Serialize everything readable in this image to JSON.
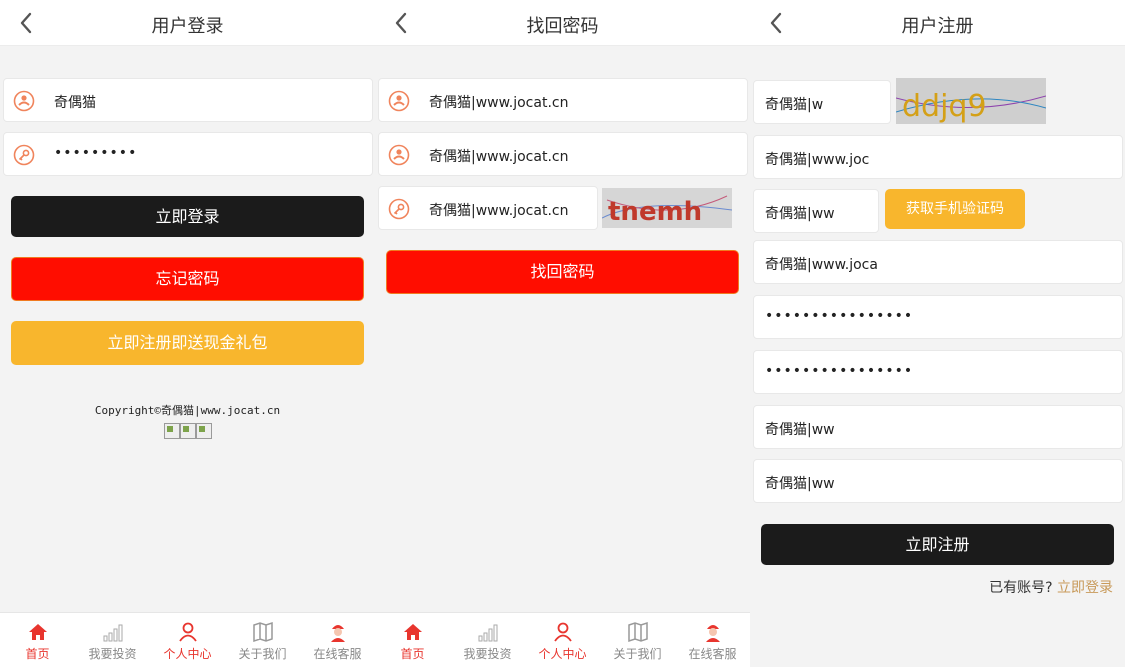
{
  "colors": {
    "accent_red": "#e8352e",
    "button_black": "#1b1b1b",
    "button_red": "#ff0d00",
    "button_yellow": "#f8b62d",
    "icon_orange": "#f0845c",
    "link_gold": "#c89a5a"
  },
  "login": {
    "title": "用户登录",
    "username": "奇偶猫",
    "password": "•••••••••",
    "login_button": "立即登录",
    "forgot_button": "忘记密码",
    "register_button": "立即注册即送现金礼包",
    "copyright": "Copyright©奇偶猫|www.jocat.cn"
  },
  "recover": {
    "title": "找回密码",
    "field1": "奇偶猫|www.jocat.cn",
    "field2": "奇偶猫|www.jocat.cn",
    "captcha_field": "奇偶猫|www.jocat.cn",
    "captcha_text": "tnemh",
    "submit_button": "找回密码"
  },
  "register": {
    "title": "用户注册",
    "captcha_field": "奇偶猫|w",
    "captcha_text": "ddjq9",
    "field_phone": "奇偶猫|www.joc",
    "sms_field": "奇偶猫|ww",
    "sms_button": "获取手机验证码",
    "field_name": "奇偶猫|www.joca",
    "password": "••••••••••••••••",
    "password_confirm": "••••••••••••••••",
    "field_extra1": "奇偶猫|ww",
    "field_extra2": "奇偶猫|ww",
    "submit_button": "立即注册",
    "have_account": "已有账号?",
    "login_link": "立即登录"
  },
  "tabbar": {
    "items": [
      {
        "label": "首页",
        "icon": "home-icon"
      },
      {
        "label": "我要投资",
        "icon": "chart-bars-icon"
      },
      {
        "label": "个人中心",
        "icon": "user-icon"
      },
      {
        "label": "关于我们",
        "icon": "map-icon"
      },
      {
        "label": "在线客服",
        "icon": "service-icon"
      }
    ]
  }
}
